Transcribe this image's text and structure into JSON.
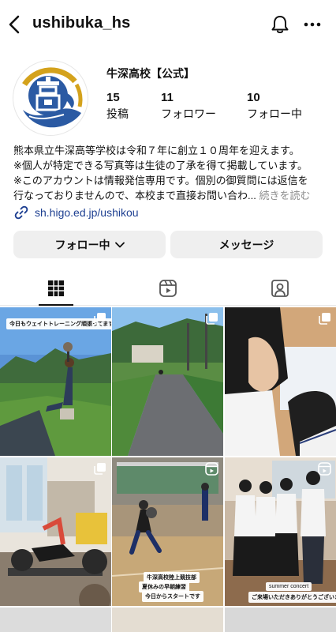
{
  "header": {
    "username": "ushibuka_hs"
  },
  "profile": {
    "display_name": "牛深高校【公式】",
    "stats": {
      "posts": {
        "value": "15",
        "label": "投稿"
      },
      "followers": {
        "value": "11",
        "label": "フォロワー"
      },
      "following": {
        "value": "10",
        "label": "フォロー中"
      }
    },
    "bio_lines": [
      "熊本県立牛深高等学校は令和７年に創立１０周年を迎えます。",
      "※個人が特定できる写真等は生徒の了承を得て掲載しています。",
      "※このアカウントは情報発信専用です。個別の御質問には返信を",
      "行なっておりませんので、本校まで直接お問い合わ..."
    ],
    "bio_more": "続きを読む",
    "link": "sh.higo.ed.jp/ushikou"
  },
  "actions": {
    "follow_label": "フォロー中",
    "message_label": "メッセージ"
  },
  "tabs": [
    "grid-icon",
    "reels-icon",
    "tagged-icon"
  ],
  "posts": {
    "p1_overlay": "今日もウェイトトレーニング頑張ってます",
    "p5_overlay1": "牛深高校陸上競技部",
    "p5_overlay2": "夏休みの早朝練習",
    "p5_overlay3": "今日からスタートです",
    "p6_overlay1": "summer concert",
    "p6_overlay2": "ご来場いただきありがとうございました！"
  },
  "colors": {
    "link": "#1d3f91",
    "button_bg": "#efefef",
    "logo_blue": "#2b5aa3",
    "logo_gold": "#d4a21c"
  }
}
